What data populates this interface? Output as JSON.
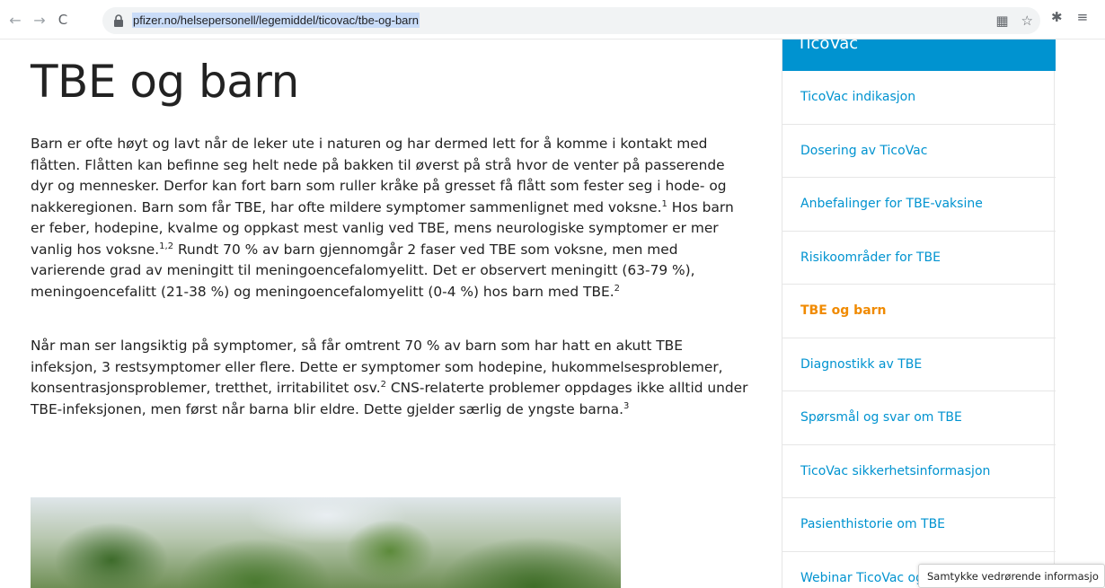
{
  "browser": {
    "url": "pfizer.no/helsepersonell/legemiddel/ticovac/tbe-og-barn",
    "back_glyph": "←",
    "forward_glyph": "→",
    "reload_glyph": "C",
    "qr_glyph": "▦",
    "star_glyph": "☆",
    "ext_glyph": "✱",
    "menu_glyph": "≡"
  },
  "main": {
    "title": "TBE og barn",
    "p1": [
      "Barn er ofte høyt og lavt når de leker ute i naturen og har dermed lett for å komme i kontakt med flåtten. Flåtten kan befinne seg helt nede på bakken til øverst på strå hvor de venter på passerende dyr og mennesker. Derfor kan fort barn som ruller kråke på gresset få flått som fester seg i hode- og nakkeregionen. Barn som får TBE, har ofte mildere symptomer sammenlignet med voksne.",
      "1",
      " Hos barn er feber, hodepine, kvalme og oppkast mest vanlig ved TBE, mens neurologiske symptomer er mer vanlig hos voksne.",
      "1,2",
      " Rundt 70 % av barn gjennomgår 2 faser ved TBE som voksne, men med varierende grad av meningitt til meningoencefalomyelitt. Det er observert meningitt (63-79 %), meningoencefalitt (21-38 %) og meningoencefalomyelitt (0-4 %) hos barn med TBE.",
      "2"
    ],
    "p2": [
      "Når man ser langsiktig på symptomer, så får omtrent 70 % av barn som har hatt en akutt TBE infeksjon, 3 restsymptomer eller flere. Dette er symptomer som hodepine, hukommelsesproblemer, konsentrasjonsproblemer, tretthet, irritabilitet osv.",
      "2",
      " CNS-relaterte problemer oppdages ikke alltid under TBE-infeksjonen, men først når barna blir eldre. Dette gjelder særlig de yngste barna.",
      "3"
    ]
  },
  "sidebar": {
    "header": "TicoVac",
    "items": [
      {
        "label": "TicoVac indikasjon",
        "active": false
      },
      {
        "label": "Dosering av TicoVac",
        "active": false
      },
      {
        "label": "Anbefalinger for TBE-vaksine",
        "active": false
      },
      {
        "label": "Risikoområder for TBE",
        "active": false
      },
      {
        "label": "TBE og barn",
        "active": true
      },
      {
        "label": "Diagnostikk av TBE",
        "active": false
      },
      {
        "label": "Spørsmål og svar om TBE",
        "active": false
      },
      {
        "label": "TicoVac sikkerhetsinformasjon",
        "active": false
      },
      {
        "label": "Pasienthistorie om TBE",
        "active": false
      },
      {
        "label": "Webinar TicoVac og",
        "active": false
      }
    ]
  },
  "cookie": {
    "label": "Samtykke vedrørende informasjo"
  },
  "colors": {
    "link": "#0093d0",
    "active": "#f08a00",
    "header_bg": "#0093d0"
  }
}
